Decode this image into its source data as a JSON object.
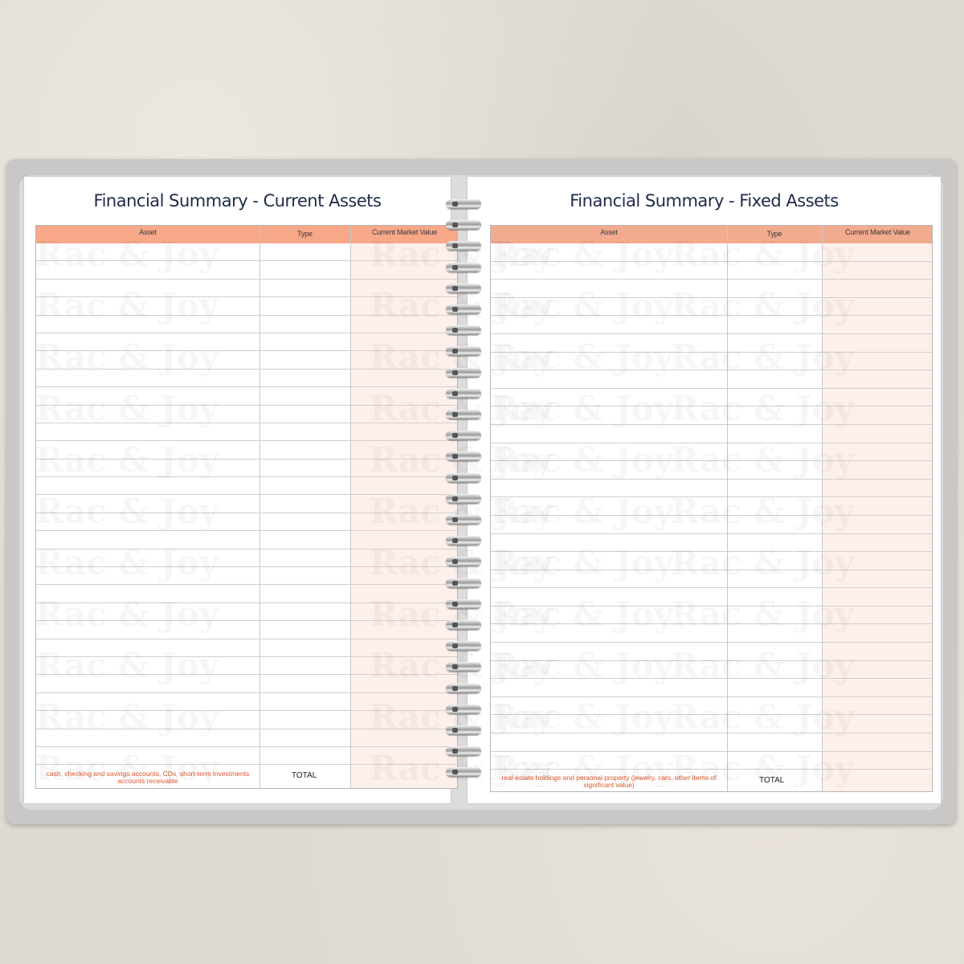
{
  "colors": {
    "header_fill": "#f7a889",
    "value_column_fill": "#fdf0ea",
    "title_text": "#1d2b4a",
    "footnote_text": "#e0552c"
  },
  "watermark_text": "Rac & Joy",
  "left_page": {
    "title": "Financial Summary - Current Assets",
    "columns": [
      "Asset",
      "Type",
      "Current Market Value"
    ],
    "footnote": "cash, checking and savings accounts, CDs, short-term investments accounts receivable",
    "total_label": "TOTAL"
  },
  "right_page": {
    "title": "Financial Summary - Fixed Assets",
    "columns": [
      "Asset",
      "Type",
      "Current Market Value"
    ],
    "footnote": "real estate holdings and personal property (jewelry, cars, other items of significant value)",
    "total_label": "TOTAL"
  }
}
